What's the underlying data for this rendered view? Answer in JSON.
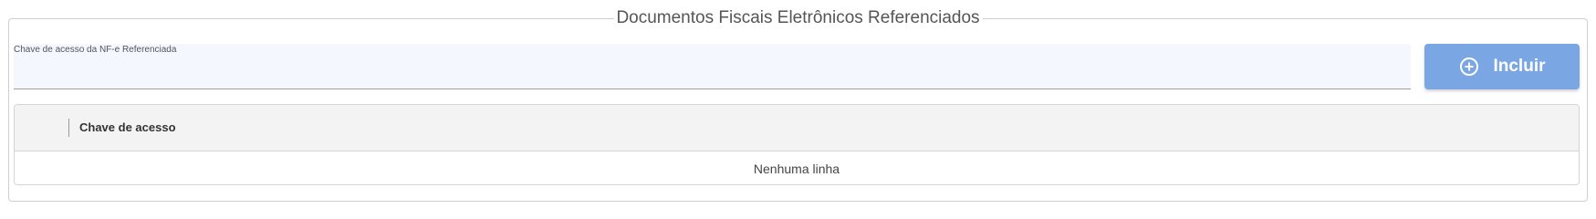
{
  "section": {
    "title": "Documentos Fiscais Eletrônicos Referenciados"
  },
  "access_key_field": {
    "label": "Chave de acesso da NF-e Referenciada",
    "value": ""
  },
  "add_button": {
    "label": "Incluir",
    "icon": "plus-circle-icon",
    "color": "#7aa7e4"
  },
  "grid": {
    "columns": [
      "Chave de acesso"
    ],
    "empty_message": "Nenhuma linha"
  }
}
